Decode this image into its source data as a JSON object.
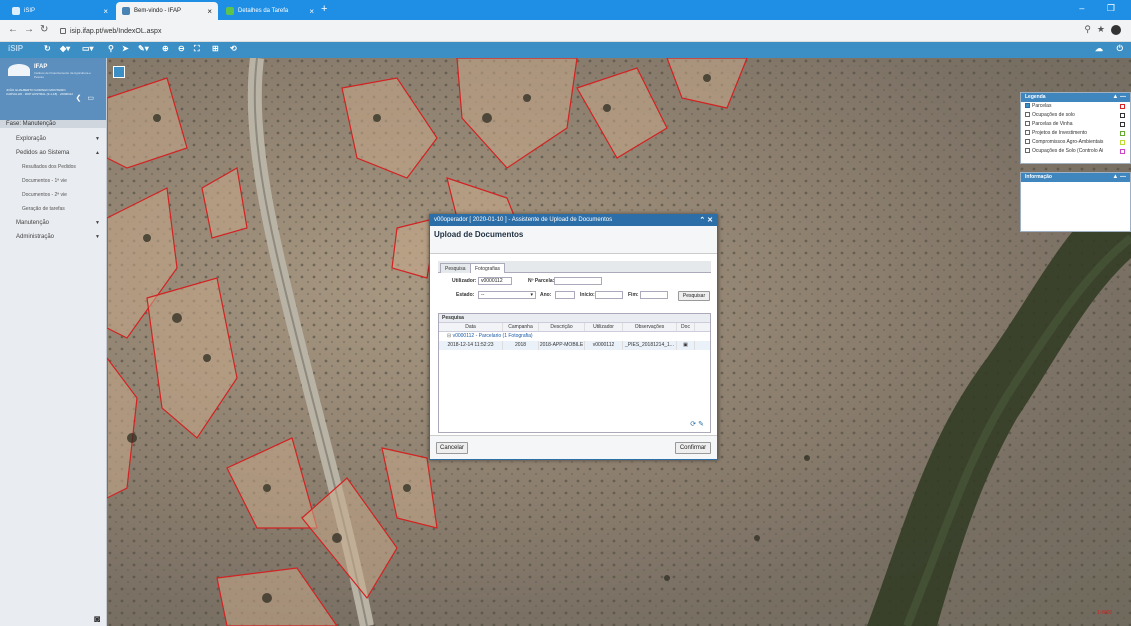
{
  "browser": {
    "tabs": [
      {
        "title": "iSIP"
      },
      {
        "title": "Bem-vindo - IFAP"
      },
      {
        "title": "Detalhes da Tarefa"
      }
    ],
    "url": "isip.ifap.pt/web/IndexOL.aspx"
  },
  "app": {
    "toolbar_brand": "iSIP",
    "logo_title": "IFAP",
    "logo_subtitle": "Instituto de Financiamento da Agricultura e Pescas",
    "user_info": "JOÃO GUALBERTO GODINHO MONTEIRO CARVALHO · ROP AUSTRAL (3-1-18) · v0000112",
    "phase": "Fase: Manutenção",
    "menu": [
      {
        "label": "Exploração",
        "sub": false,
        "caret": "▼"
      },
      {
        "label": "Pedidos ao Sistema",
        "sub": false,
        "caret": "▲"
      },
      {
        "label": "Resultados dos Pedidos",
        "sub": true,
        "caret": ""
      },
      {
        "label": "Documentos - 1ª vie",
        "sub": true,
        "caret": ""
      },
      {
        "label": "Documentos - 2ª vie",
        "sub": true,
        "caret": ""
      },
      {
        "label": "Geração de tarefas",
        "sub": true,
        "caret": ""
      },
      {
        "label": "Manutenção",
        "sub": false,
        "caret": "▼"
      },
      {
        "label": "Administração",
        "sub": false,
        "caret": "▼"
      }
    ]
  },
  "legend": {
    "title": "Legenda",
    "layers": [
      {
        "label": "Parcelas",
        "checked": true,
        "color": "#d22"
      },
      {
        "label": "Ocupações de solo",
        "checked": false,
        "color": "#333"
      },
      {
        "label": "Parcelas de Vinha",
        "checked": false,
        "color": "#333"
      },
      {
        "label": "Projetos de Investimento",
        "checked": false,
        "color": "#6a3"
      },
      {
        "label": "Compromissos Agro-Ambientais",
        "checked": false,
        "color": "#bd3"
      },
      {
        "label": "Ocupações de Solo (Controlo Ai",
        "checked": false,
        "color": "#c4c"
      }
    ]
  },
  "info_panel": {
    "title": "Informação"
  },
  "dialog": {
    "title": "v00operador [ 2020-01-10 ] - Assistente de Upload de Documentos",
    "heading": "Upload de Documentos",
    "tabs": [
      "Pesquisa",
      "Fotografias"
    ],
    "form": {
      "utilizador_label": "Utilizador:",
      "utilizador_value": "v0000112",
      "parcela_label": "Nº Parcela:",
      "parcela_value": "",
      "estado_label": "Estado:",
      "estado_value": "--",
      "ano_label": "Ano:",
      "inicio_label": "Início:",
      "fim_label": "Fim:",
      "search_button": "Pesquisar"
    },
    "grid": {
      "title": "Pesquisa",
      "columns": [
        "Data",
        "Campanha",
        "Descrição",
        "Utilizador",
        "Observações",
        "Doc"
      ],
      "group_label": "v0000112 - Parcelario (1 Fotografia)",
      "rows": [
        [
          "2018-12-14 11:52:23",
          "2018",
          "2018-APP-MOBILE",
          "v0000112",
          "_PIES_20181214_1...",
          "▣"
        ]
      ]
    },
    "cancel_button": "Cancelar",
    "confirm_button": "Confirmar"
  }
}
